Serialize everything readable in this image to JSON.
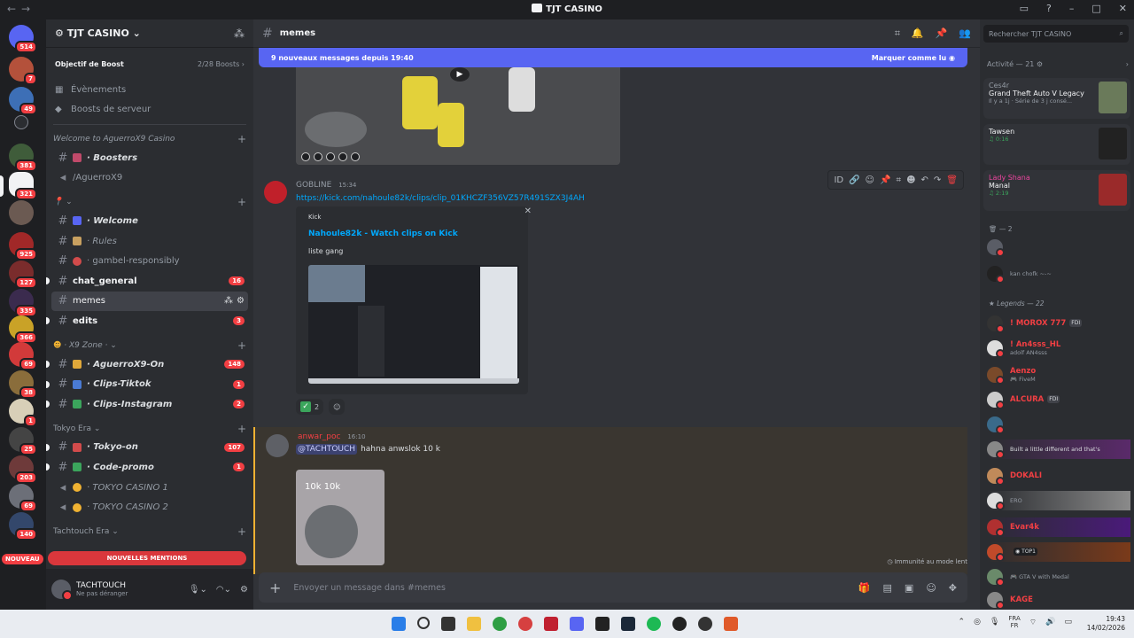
{
  "window": {
    "title": "TJT CASINO"
  },
  "rail": {
    "badges": [
      "514",
      "7",
      "49",
      "381",
      "321",
      "925",
      "127",
      "335",
      "366",
      "69",
      "38",
      "1",
      "25",
      "203",
      "69",
      "140"
    ],
    "new_label": "NOUVEAU"
  },
  "sidebar": {
    "guild_name": "TJT CASINO",
    "boost_goal": "Objectif de Boost",
    "boost_count": "2/28 Boosts",
    "events": "Évènements",
    "server_boosts": "Boosts de serveur",
    "cat1": "Welcome to AguerroX9 Casino",
    "ch_boosters": "· Boosters",
    "ch_aguerro": "/AguerroX9",
    "cat2": "",
    "ch_welcome": "· Welcome",
    "ch_rules": "· Rules",
    "ch_gambel": "· gambel-responsibly",
    "ch_chat": "chat_general",
    "ch_chat_count": "16",
    "ch_memes": "memes",
    "ch_edits": "edits",
    "ch_edits_count": "3",
    "cat3": "· X9 Zone ·",
    "ch_aguerro_on": "· AguerroX9-On",
    "ch_aguerro_on_count": "148",
    "ch_tiktok": "· Clips-Tiktok",
    "ch_tiktok_count": "1",
    "ch_insta": "· Clips-Instagram",
    "ch_insta_count": "2",
    "cat4": "Tokyo Era",
    "ch_tokyo": "· Tokyo-on",
    "ch_tokyo_count": "107",
    "ch_promo": "· Code-promo",
    "ch_promo_count": "1",
    "ch_voice1": "· TOKYO CASINO",
    "ch_voice1_count": "1",
    "ch_voice2": "· TOKYO CASINO",
    "ch_voice2_count": "2",
    "cat5": "Tachtouch Era",
    "mentions_label": "NOUVELLES MENTIONS",
    "user_name": "TACHTOUCH",
    "user_status": "Ne pas déranger"
  },
  "main": {
    "channel": "memes",
    "new_messages": "9 nouveaux messages depuis 19:40",
    "mark_read": "Marquer comme lu",
    "msg1_author": "GOBLINE",
    "msg1_time": "15:34",
    "msg1_link": "https://kick.com/nahoule82k/clips/clip_01KHCZF356VZ57R491SZX3J4AH",
    "embed_provider": "Kick",
    "embed_title": "Nahoule82k - Watch clips on Kick",
    "embed_desc": "liste gang",
    "reaction_count": "2",
    "msg2_author": "anwar_poc",
    "msg2_time": "16:10",
    "msg2_mention": "@TACHTOUCH",
    "msg2_text": "hahna anwslok 10 k",
    "msg2_image_caption": "10k 10k",
    "slowmode": "Immunité au mode lent",
    "composer_placeholder": "Envoyer un message dans #memes"
  },
  "members": {
    "search_placeholder": "Rechercher TJT CASINO",
    "activity_header": "Activité — 21",
    "card1_name": "Ces4r",
    "card1_title": "Grand Theft Auto V Legacy",
    "card1_sub": "Il y a 1j · Série de 3 j consé...",
    "card2_name": "",
    "card2_title": "Tawsen",
    "card2_sub": "0:16",
    "card3_name": "Lady Shana",
    "card3_title": "Manal",
    "card3_sub": "2:19",
    "group1": "— 2",
    "m_kan_status": "kan chofk ~-~",
    "group2": "Legends — 22",
    "m1": "! MOROX 777",
    "m1_tag": "FDI",
    "m2": "! An4sss_HL",
    "m2_sub": "adolf AN4sss",
    "m3": "Aenzo",
    "m3_sub": "FiveM",
    "m4": "ALCURA",
    "m4_tag": "FDI",
    "m5": "",
    "m6": "",
    "m6_sub": "Built a little different and that's",
    "m7": "DOKALI",
    "m8": "",
    "m8_sub": "ERO",
    "m9": "Evar4k",
    "m10": "",
    "m10_tag": "TOP1",
    "m11": "",
    "m11_sub": "GTA V with Medal",
    "m12": "KAGE"
  },
  "taskbar": {
    "lang1": "FRA",
    "lang2": "FR",
    "time": "19:43",
    "date": "14/02/2026"
  }
}
